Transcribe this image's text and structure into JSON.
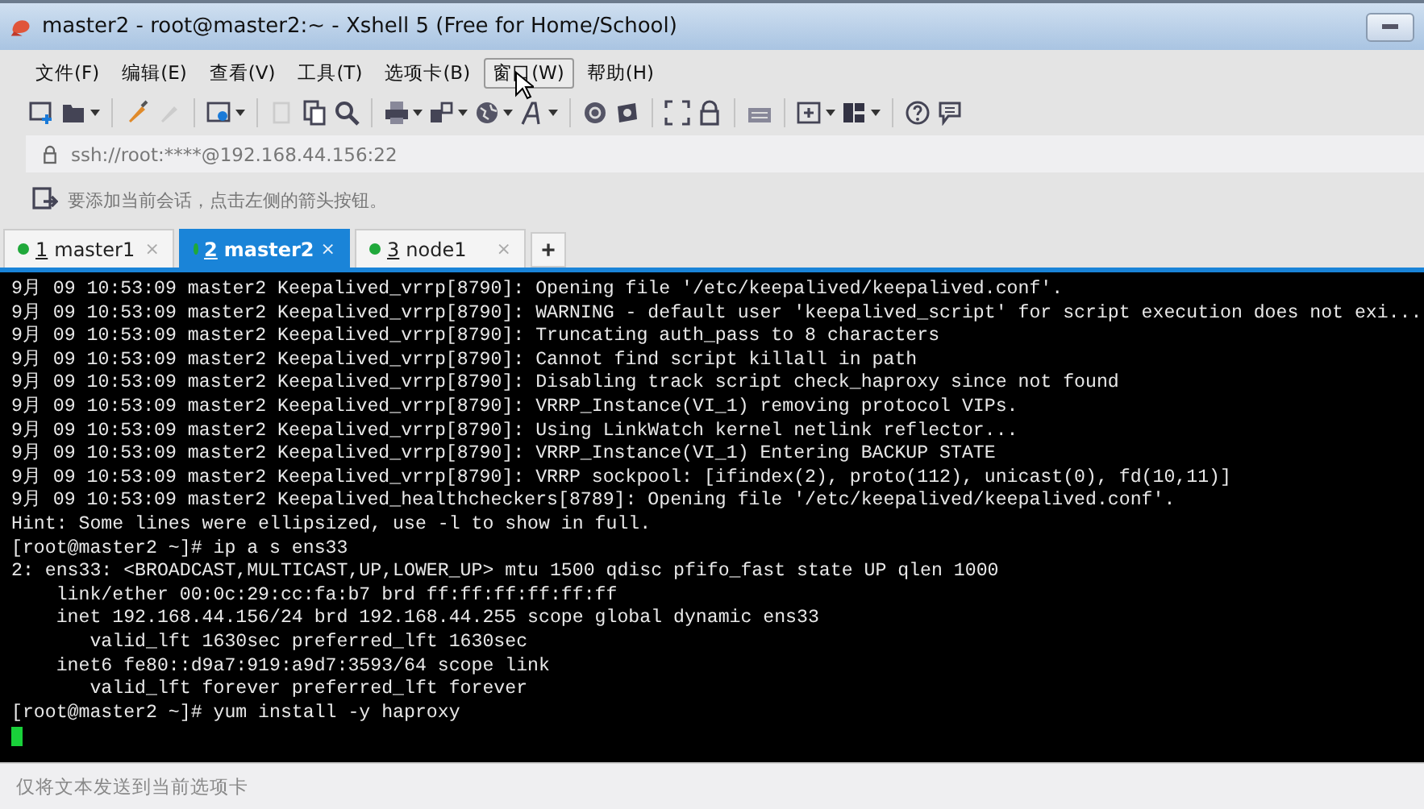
{
  "window": {
    "title": "master2 - root@master2:~ - Xshell 5 (Free for Home/School)"
  },
  "menu": [
    {
      "label": "文件(F)",
      "selected": false
    },
    {
      "label": "编辑(E)",
      "selected": false
    },
    {
      "label": "查看(V)",
      "selected": false
    },
    {
      "label": "工具(T)",
      "selected": false
    },
    {
      "label": "选项卡(B)",
      "selected": false
    },
    {
      "label": "窗口(W)",
      "selected": true
    },
    {
      "label": "帮助(H)",
      "selected": false
    }
  ],
  "address": {
    "value": "ssh://root:****@192.168.44.156:22"
  },
  "hint": "要添加当前会话，点击左侧的箭头按钮。",
  "tabs": [
    {
      "number": "1",
      "name": "master1",
      "close": "×",
      "selected": false
    },
    {
      "number": "2",
      "name": "master2",
      "close": "×",
      "selected": true
    },
    {
      "number": "3",
      "name": "node1",
      "close": "×",
      "selected": false
    }
  ],
  "new_tab": "+",
  "terminal": {
    "lines": [
      "9月 09 10:53:09 master2 Keepalived_vrrp[8790]: Opening file '/etc/keepalived/keepalived.conf'.",
      "9月 09 10:53:09 master2 Keepalived_vrrp[8790]: WARNING - default user 'keepalived_script' for script execution does not exi...",
      "9月 09 10:53:09 master2 Keepalived_vrrp[8790]: Truncating auth_pass to 8 characters",
      "9月 09 10:53:09 master2 Keepalived_vrrp[8790]: Cannot find script killall in path",
      "9月 09 10:53:09 master2 Keepalived_vrrp[8790]: Disabling track script check_haproxy since not found",
      "9月 09 10:53:09 master2 Keepalived_vrrp[8790]: VRRP_Instance(VI_1) removing protocol VIPs.",
      "9月 09 10:53:09 master2 Keepalived_vrrp[8790]: Using LinkWatch kernel netlink reflector...",
      "9月 09 10:53:09 master2 Keepalived_vrrp[8790]: VRRP_Instance(VI_1) Entering BACKUP STATE",
      "9月 09 10:53:09 master2 Keepalived_vrrp[8790]: VRRP sockpool: [ifindex(2), proto(112), unicast(0), fd(10,11)]",
      "9月 09 10:53:09 master2 Keepalived_healthcheckers[8789]: Opening file '/etc/keepalived/keepalived.conf'.",
      "Hint: Some lines were ellipsized, use -l to show in full.",
      "[root@master2 ~]# ip a s ens33",
      "2: ens33: <BROADCAST,MULTICAST,UP,LOWER_UP> mtu 1500 qdisc pfifo_fast state UP qlen 1000",
      "    link/ether 00:0c:29:cc:fa:b7 brd ff:ff:ff:ff:ff:ff",
      "    inet 192.168.44.156/24 brd 192.168.44.255 scope global dynamic ens33",
      "       valid_lft 1630sec preferred_lft 1630sec",
      "    inet6 fe80::d9a7:919:a9d7:3593/64 scope link",
      "       valid_lft forever preferred_lft forever",
      "[root@master2 ~]# yum install -y haproxy"
    ]
  },
  "compose": {
    "placeholder": "仅将文本发送到当前选项卡"
  }
}
